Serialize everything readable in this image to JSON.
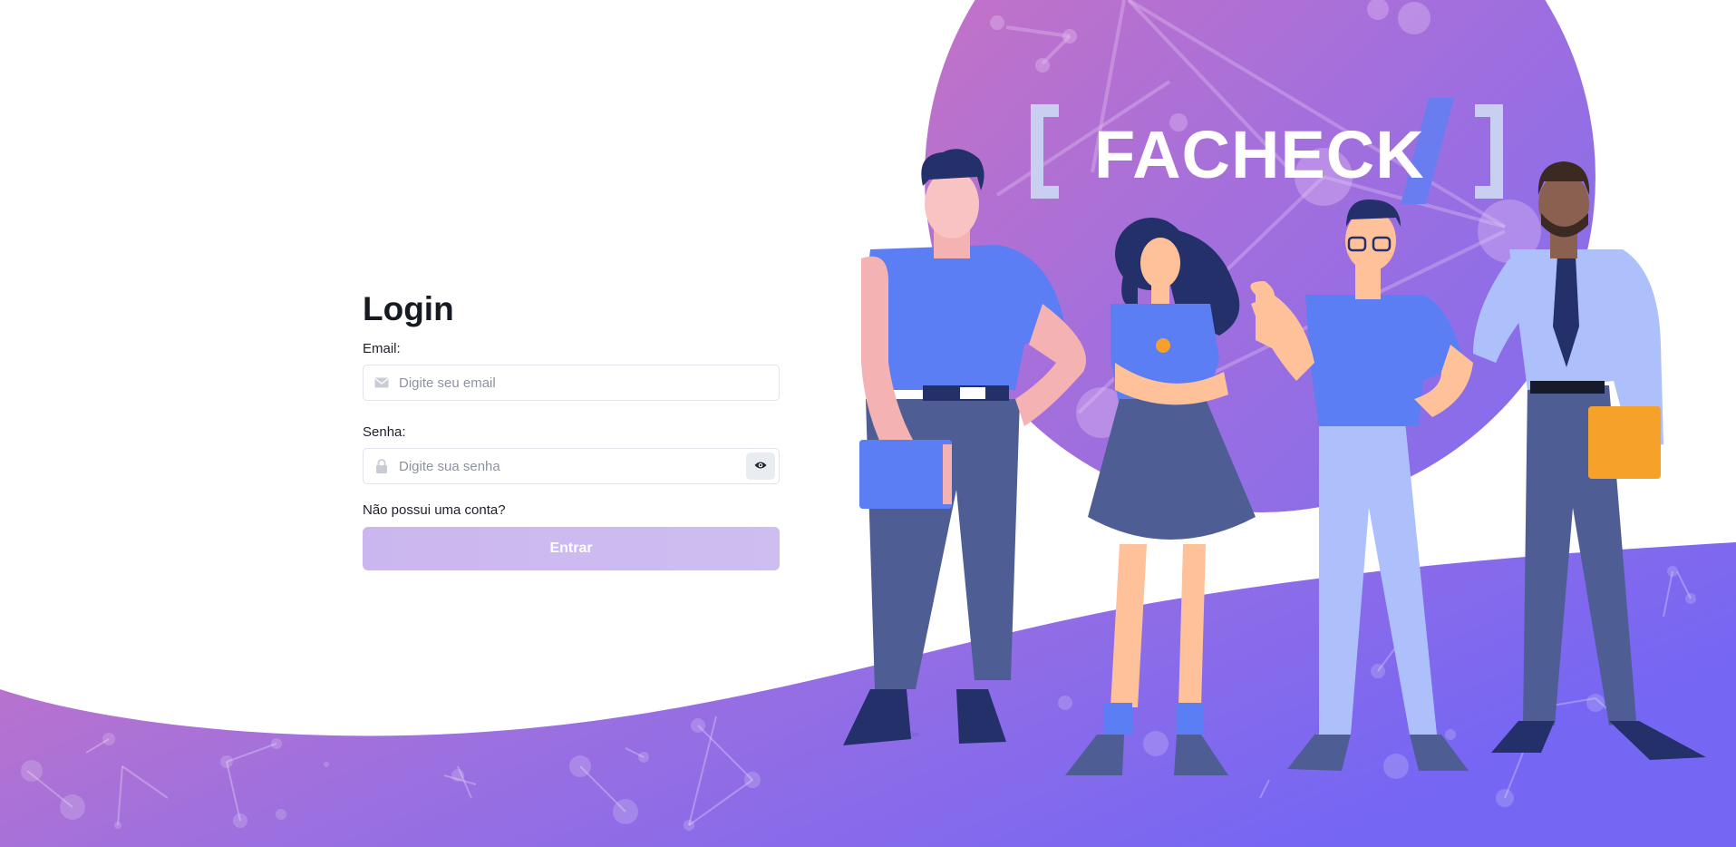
{
  "login": {
    "title": "Login",
    "email_label": "Email:",
    "email_placeholder": "Digite seu email",
    "email_value": "",
    "password_label": "Senha:",
    "password_placeholder": "Digite sua senha",
    "password_value": "",
    "register_link": "Não possui uma conta?",
    "submit_label": "Entrar"
  },
  "brand": {
    "logo_text": "FACHECK",
    "logo_open_bracket": "[",
    "logo_close_bracket": "]",
    "logo_slash": "/"
  },
  "icons": {
    "email": "envelope-icon",
    "password": "lock-icon",
    "toggle": "eye-icon"
  },
  "colors": {
    "brand_purple": "#9b6ee6",
    "brand_pink": "#c874c4",
    "brand_blue": "#6e6cf5",
    "button_disabled": "#cbb7ef",
    "text_dark": "#161a22"
  }
}
